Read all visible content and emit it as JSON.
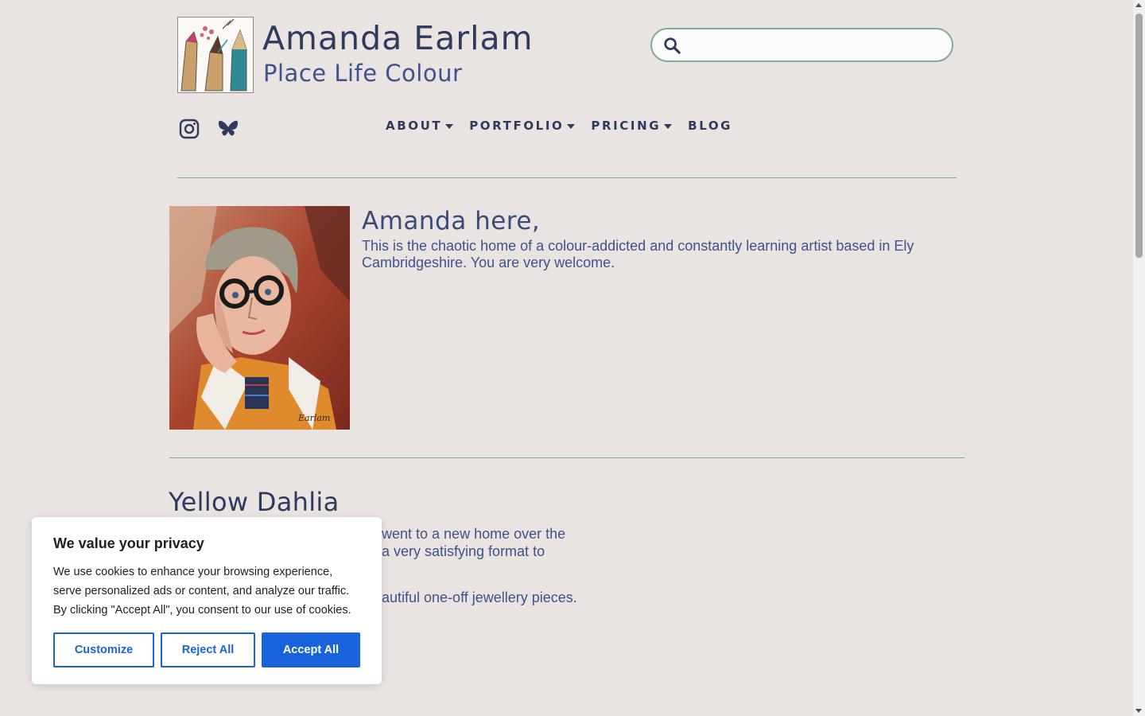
{
  "header": {
    "site_title": "Amanda Earlam",
    "tagline": "Place Life Colour",
    "search": {
      "placeholder": "",
      "value": ""
    },
    "social": [
      "instagram-icon",
      "bluesky-icon"
    ]
  },
  "nav": {
    "items": [
      {
        "label": "ABOUT",
        "has_dropdown": true
      },
      {
        "label": "PORTFOLIO",
        "has_dropdown": true
      },
      {
        "label": "PRICING",
        "has_dropdown": true
      },
      {
        "label": "BLOG",
        "has_dropdown": false
      }
    ]
  },
  "intro": {
    "heading": "Amanda here,",
    "text": "This is the chaotic home of a colour-addicted and constantly learning artist based in Ely Cambridgeshire.  You are very welcome."
  },
  "post": {
    "title": "Yellow Dahlia",
    "lines": [
      "went to a new home over the",
      "a very satisfying format to",
      "autiful one-off jewellery pieces."
    ]
  },
  "cookie": {
    "title": "We value your privacy",
    "text": "We use cookies to enhance your browsing experience, serve personalized ads or content, and analyze our traffic. By clicking \"Accept All\", you consent to our use of cookies.",
    "customize": "Customize",
    "reject": "Reject All",
    "accept": "Accept All"
  },
  "colors": {
    "background": "#e9e3e2",
    "heading": "#2f3a5e",
    "text": "#3f528c",
    "accent_green": "#7fae96",
    "cookie_blue": "#1863dc"
  }
}
